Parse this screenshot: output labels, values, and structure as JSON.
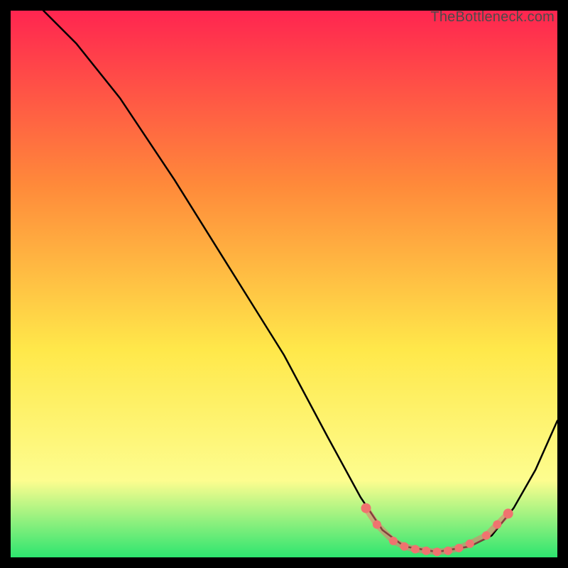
{
  "watermark": "TheBottleneck.com",
  "chart_data": {
    "type": "line",
    "title": "",
    "xlabel": "",
    "ylabel": "",
    "xlim": [
      0,
      100
    ],
    "ylim": [
      0,
      100
    ],
    "background_gradient": {
      "top": "#ff2550",
      "mid1": "#ff8a3a",
      "mid2": "#ffe84a",
      "mid3": "#fdfd8f",
      "bottom": "#2de56f"
    },
    "curve": {
      "name": "bottleneck-curve",
      "color": "#000000",
      "points": [
        {
          "x": 6,
          "y": 100
        },
        {
          "x": 12,
          "y": 94
        },
        {
          "x": 20,
          "y": 84
        },
        {
          "x": 30,
          "y": 69
        },
        {
          "x": 40,
          "y": 53
        },
        {
          "x": 50,
          "y": 37
        },
        {
          "x": 58,
          "y": 22
        },
        {
          "x": 64,
          "y": 11
        },
        {
          "x": 68,
          "y": 5
        },
        {
          "x": 72,
          "y": 2
        },
        {
          "x": 78,
          "y": 1
        },
        {
          "x": 84,
          "y": 2
        },
        {
          "x": 88,
          "y": 4
        },
        {
          "x": 92,
          "y": 9
        },
        {
          "x": 96,
          "y": 16
        },
        {
          "x": 100,
          "y": 25
        }
      ]
    },
    "markers": {
      "color": "#ef736f",
      "points": [
        {
          "x": 65,
          "y": 9
        },
        {
          "x": 67,
          "y": 6
        },
        {
          "x": 70,
          "y": 3
        },
        {
          "x": 72,
          "y": 2
        },
        {
          "x": 74,
          "y": 1.5
        },
        {
          "x": 76,
          "y": 1.2
        },
        {
          "x": 78,
          "y": 1
        },
        {
          "x": 80,
          "y": 1.2
        },
        {
          "x": 82,
          "y": 1.7
        },
        {
          "x": 84,
          "y": 2.5
        },
        {
          "x": 87,
          "y": 4
        },
        {
          "x": 89,
          "y": 6
        },
        {
          "x": 91,
          "y": 8
        }
      ]
    }
  }
}
